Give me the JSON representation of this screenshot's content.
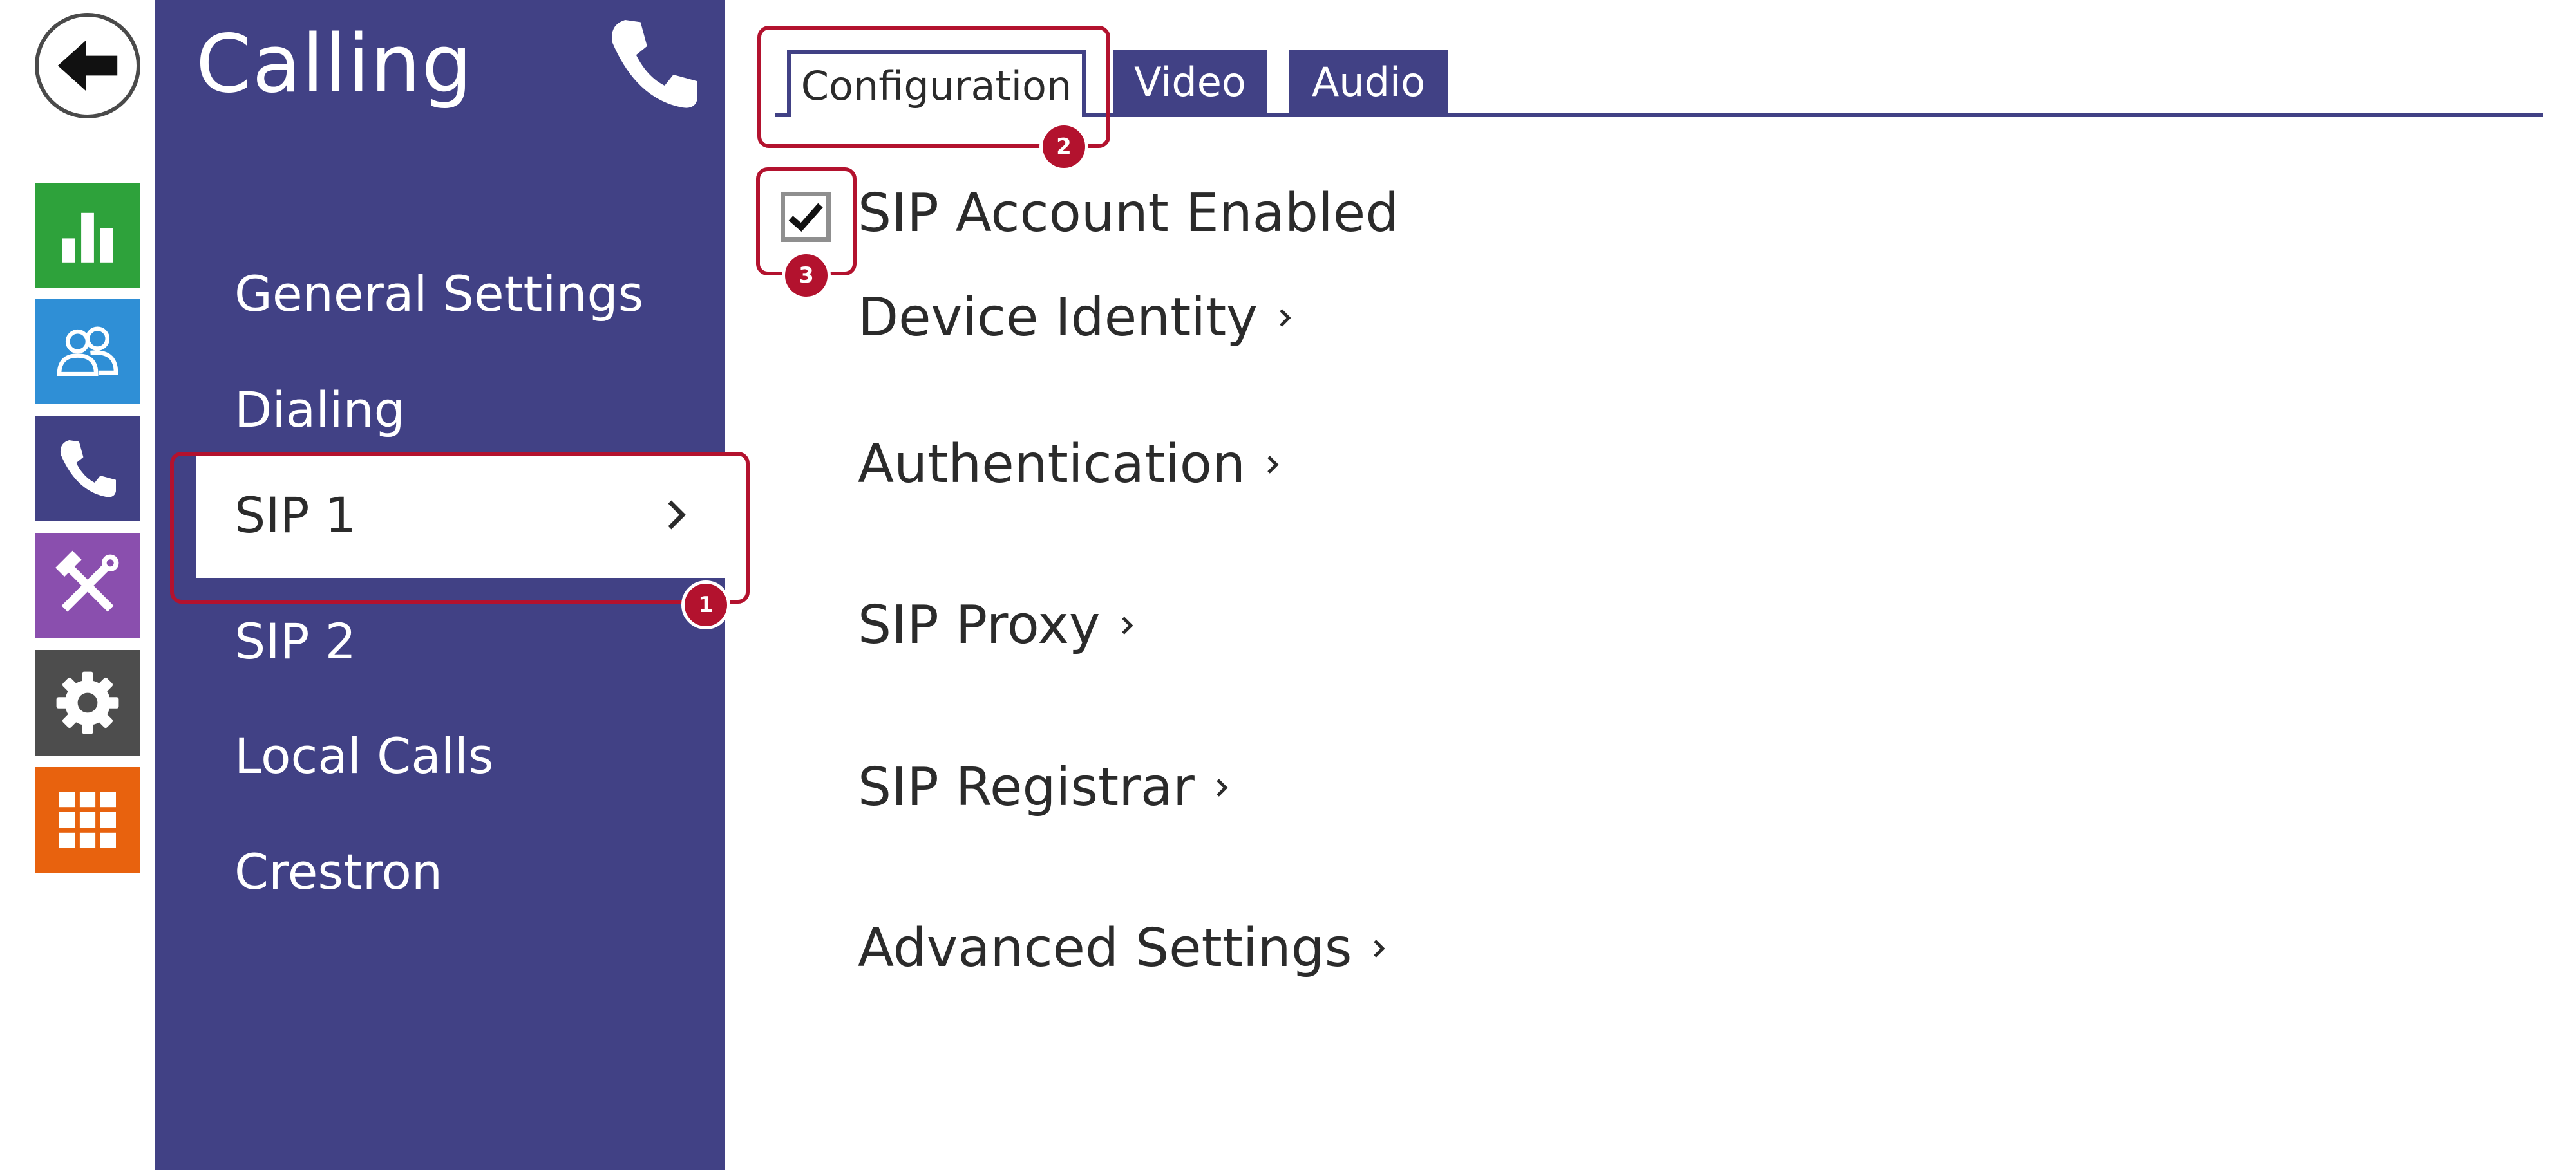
{
  "page": {
    "title": "Calling"
  },
  "colors": {
    "sidebar": "#414185",
    "stats_tile": "#2ea23b",
    "users_tile": "#2f8fd6",
    "calling_tile": "#414185",
    "services_tile": "#8a4fae",
    "system_tile": "#4d4d4d",
    "apps_tile": "#e8620e",
    "annotation": "#b3122e"
  },
  "rail": {
    "icons": [
      "back-arrow-icon",
      "bar-chart-icon",
      "users-icon",
      "phone-icon",
      "tools-icon",
      "gear-icon",
      "grid-icon"
    ]
  },
  "sidebar": {
    "title": "Calling",
    "items": [
      {
        "label": "General Settings"
      },
      {
        "label": "Dialing"
      },
      {
        "label": "SIP 1",
        "active": true
      },
      {
        "label": "SIP 2"
      },
      {
        "label": "Local Calls"
      },
      {
        "label": "Crestron"
      }
    ]
  },
  "tabs": [
    {
      "label": "Configuration",
      "active": true
    },
    {
      "label": "Video"
    },
    {
      "label": "Audio"
    }
  ],
  "content": {
    "sip_account_enabled": {
      "label": "SIP Account Enabled",
      "checked": true
    },
    "sections": [
      {
        "label": "Device Identity"
      },
      {
        "label": "Authentication"
      },
      {
        "label": "SIP Proxy"
      },
      {
        "label": "SIP Registrar"
      },
      {
        "label": "Advanced Settings"
      }
    ]
  },
  "annotations": [
    {
      "number": "1"
    },
    {
      "number": "2"
    },
    {
      "number": "3"
    }
  ]
}
